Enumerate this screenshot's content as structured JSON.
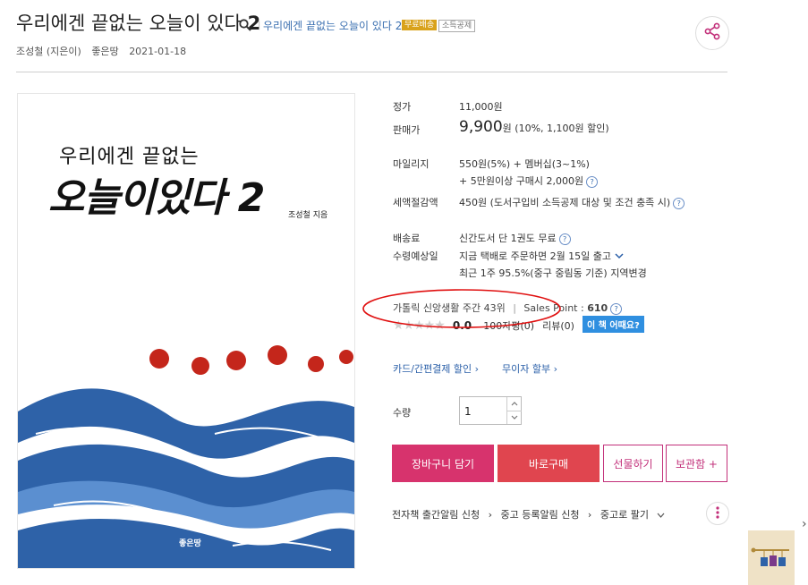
{
  "header": {
    "title": "우리에겐 끝없는 오늘이 있다",
    "title_num": "2",
    "subtitle": "우리에겐 끝없는 오늘이 있다 2",
    "badge_ship": "무료배송",
    "badge_tax": "소득공제",
    "author": "조성철 (지은이)",
    "publisher": "좋은땅",
    "date": "2021-01-18"
  },
  "cover": {
    "line1": "우리에겐 끝없는",
    "line2": "오늘이있다 2",
    "author": "조성철 지음",
    "publisher": "좋은땅",
    "colors": {
      "dots": "#c4261b",
      "wave_dark": "#2e62a8",
      "wave_light": "#5b8fd0"
    }
  },
  "info": {
    "list_price_label": "정가",
    "list_price": "11,000원",
    "sale_price_label": "판매가",
    "sale_price_num": "9,900",
    "sale_price_unit": "원",
    "sale_price_note": "(10%, 1,100원 할인)",
    "mileage_label": "마일리지",
    "mileage_line1": "550원(5%) + 멤버십(3~1%)",
    "mileage_line2": "+ 5만원이상 구매시 2,000원",
    "tax_label": "세액절감액",
    "tax_value": "450원 (도서구입비 소득공제 대상 및 조건 충족 시)",
    "shipping_label": "배송료",
    "shipping_value": "신간도서 단 1권도 무료",
    "receive_label": "수령예상일",
    "receive_line1": "지금 택배로 주문하면 2월 15일 출고",
    "receive_line2": "최근 1주 95.5%(중구 중림동 기준) 지역변경",
    "rank_text": "가톨릭 신앙생활 주간 43위",
    "sales_point_label": "Sales Point :",
    "sales_point_value": "610",
    "rating": "0.0",
    "review100": "100자평(0)",
    "review": "리뷰(0)",
    "ask_button": "이 책 어때요?",
    "card_link": "카드/간편결제 할인",
    "installment_link": "무이자 할부",
    "qty_label": "수량",
    "qty_value": "1"
  },
  "buttons": {
    "cart": "장바구니 담기",
    "buy": "바로구매",
    "gift": "선물하기",
    "keep": "보관함 +"
  },
  "bottom_links": {
    "ebook": "전자책 출간알림 신청",
    "used_alert": "중고 등록알림 신청",
    "used_sell": "중고로 팔기"
  },
  "colors": {
    "accent_pink": "#d7336d",
    "accent_red": "#e0454f",
    "link_blue": "#2a5fa8",
    "annotation_red": "#e01010"
  },
  "icons": [
    "search-icon",
    "share-icon",
    "chevron-down-icon",
    "question-icon",
    "more-icon",
    "chevron-right-icon"
  ]
}
